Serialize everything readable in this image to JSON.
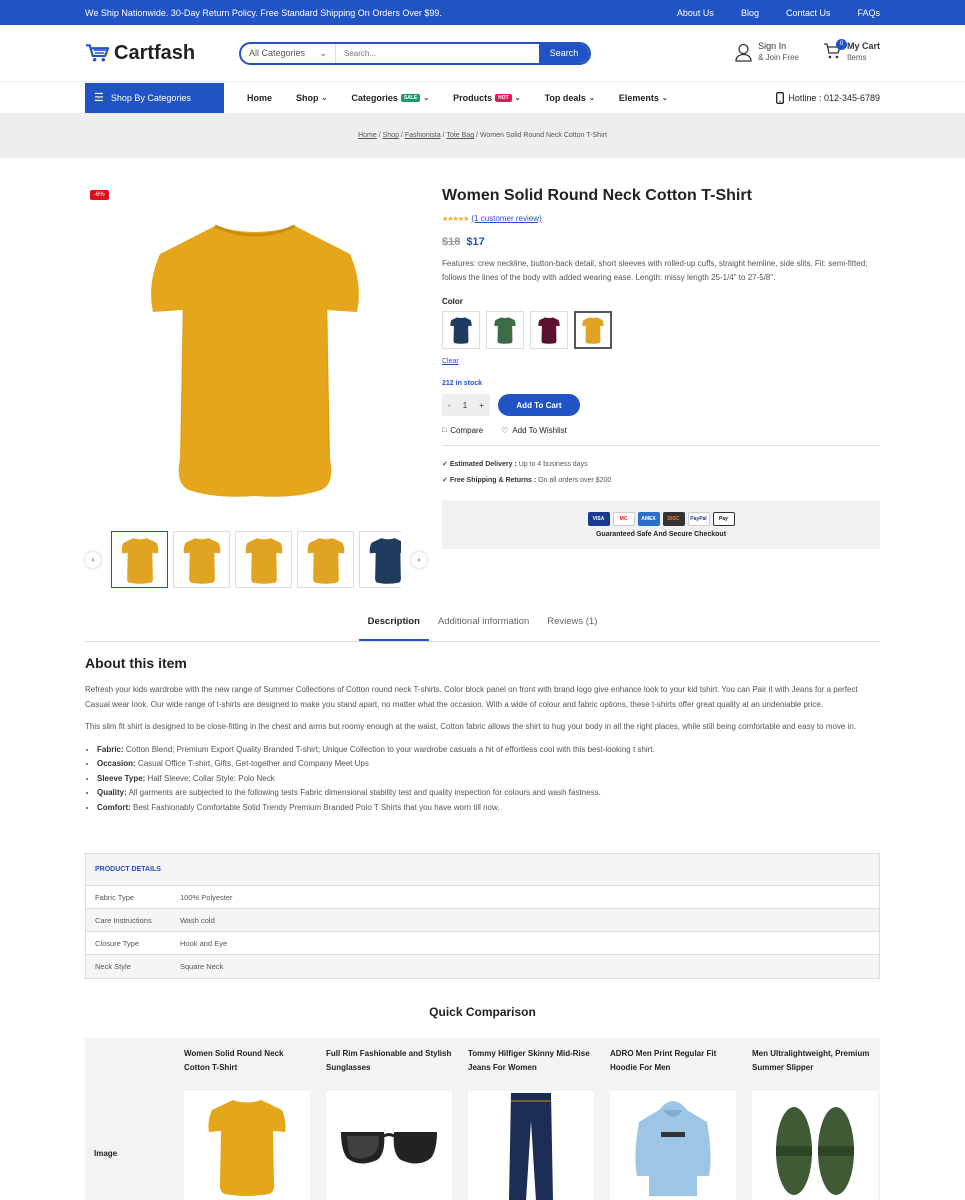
{
  "topbar": {
    "notice": "We Ship Nationwide. 30-Day Return Policy. Free Standard Shipping On Orders Over $99.",
    "links": [
      "About Us",
      "Blog",
      "Contact Us",
      "FAQs"
    ]
  },
  "header": {
    "logo": "Cartfash",
    "search_category": "All Categories",
    "search_placeholder": "Search...",
    "search_button": "Search",
    "signin_title": "Sign In",
    "signin_sub": "& Join Free",
    "cart_title": "My Cart",
    "cart_sub": "Items",
    "cart_count": "0"
  },
  "nav": {
    "categories_button": "Shop By Categories",
    "items": [
      {
        "label": "Home",
        "tag": "",
        "chevron": false
      },
      {
        "label": "Shop",
        "tag": "",
        "chevron": true
      },
      {
        "label": "Categories",
        "tag": "SALE",
        "chevron": true
      },
      {
        "label": "Products",
        "tag": "HOT",
        "chevron": true
      },
      {
        "label": "Top deals",
        "tag": "",
        "chevron": true
      },
      {
        "label": "Elements",
        "tag": "",
        "chevron": true
      }
    ],
    "hotline": "Hotline : 012-345-6789"
  },
  "breadcrumb": {
    "links": [
      "Home",
      "Shop",
      "Fashionista",
      "Tote Bag"
    ],
    "current": "Women Solid Round Neck Cotton T-Shirt"
  },
  "product": {
    "discount_badge": "-6%",
    "title": "Women Solid Round Neck Cotton T-Shirt",
    "rating_stars": 5,
    "review_link": "(1 customer review)",
    "old_price": "$18",
    "new_price": "$17",
    "description": "Features: crew neckline, button-back detail, short sleeves with rolled-up cuffs, straight hemline, side slits. Fit: semi-fitted; follows the lines of the body with added wearing ease. Length: missy length 25-1/4\" to 27-5/8\".",
    "color_label": "Color",
    "swatches": [
      "#1f3c5e",
      "#3d6b47",
      "#5a1230",
      "#e0a422"
    ],
    "selected_swatch": 3,
    "clear": "Clear",
    "stock": "212 in stock",
    "qty_minus": "-",
    "qty": "1",
    "qty_plus": "+",
    "add_to_cart": "Add To Cart",
    "compare": "Compare",
    "wishlist": "Add To Wishlist",
    "delivery_label": "Estimated Delivery :",
    "delivery_value": "Up to 4 business days",
    "shipping_label": "Free Shipping & Returns :",
    "shipping_value": "On all orders over $200",
    "secure_caption": "Guaranteed Safe And Secure Checkout",
    "cards": [
      "VISA",
      "MC",
      "AMEX",
      "DISC",
      "PayPal",
      "Pay"
    ],
    "thumb_colors": [
      "#e0a422",
      "#e0a422",
      "#e0a422",
      "#e0a422",
      "#1f3c5e"
    ]
  },
  "tabs": [
    "Description",
    "Additional information",
    "Reviews (1)"
  ],
  "about": {
    "title": "About this item",
    "p1": "Refresh your kids wardrobe with the new range of Summer Collections of Cotton round neck T-shirts. Color block panel on front with brand logo give enhance look to your kid tshirt. You can Pair it with Jeans for a perfect Casual wear look. Our wide range of t-shirts are designed to make you stand apart, no matter what the occasion. With a wide of colour and fabric options, these t-shirts offer great quality at an undeniable price.",
    "p2": "This slim fit shirt is designed to be close-fitting in the chest and arms but roomy enough at the waist, Cotton fabric allows the shirt to hug your body in all the right places, while still being comfortable and easy to move in.",
    "bullets": [
      {
        "k": "Fabric:",
        "v": " Cotton Blend; Premium Export Quality Branded T-shirt; Unique Collection to your wardrobe casuals a hit of effortless cool with this best-looking t shirt."
      },
      {
        "k": "Occasion:",
        "v": " Casual Office T-shirt, Gifts, Get-together and Company Meet Ups"
      },
      {
        "k": "Sleeve Type:",
        "v": " Half Sleeve; Collar Style: Polo Neck"
      },
      {
        "k": "Quality:",
        "v": " All garments are subjected to the following tests Fabric dimensional stability test and quality inspection for colours and wash fastness."
      },
      {
        "k": "Comfort:",
        "v": " Best Fashionably Comfortable Solid Trendy Premium Branded Polo T Shirts that you have worn till now."
      }
    ]
  },
  "details": {
    "heading": "PRODUCT DETAILS",
    "rows": [
      {
        "k": "Fabric Type",
        "v": "100% Polyester"
      },
      {
        "k": "Care Instructions",
        "v": "Wash cold"
      },
      {
        "k": "Closure Type",
        "v": "Hook and Eye"
      },
      {
        "k": "Neck Style",
        "v": "Square Neck"
      }
    ]
  },
  "comparison": {
    "title": "Quick Comparison",
    "image_label": "Image",
    "products": [
      {
        "name": "Women Solid Round Neck Cotton T-Shirt",
        "icon": "tshirt-icon"
      },
      {
        "name": "Full Rim Fashionable and Stylish Sunglasses",
        "icon": "sunglasses-icon"
      },
      {
        "name": "Tommy Hilfiger Skinny Mid-Rise Jeans For Women",
        "icon": "jeans-icon"
      },
      {
        "name": "ADRO Men Print Regular Fit Hoodie For Men",
        "icon": "hoodie-icon"
      },
      {
        "name": "Men Ultralightweight, Premium Summer Slipper",
        "icon": "slipper-icon"
      }
    ]
  },
  "colors": {
    "accent": "#2153c4",
    "sale": "#1a9b6e",
    "hot": "#e8175d",
    "discount": "#e10c18",
    "product": "#e0a422"
  }
}
